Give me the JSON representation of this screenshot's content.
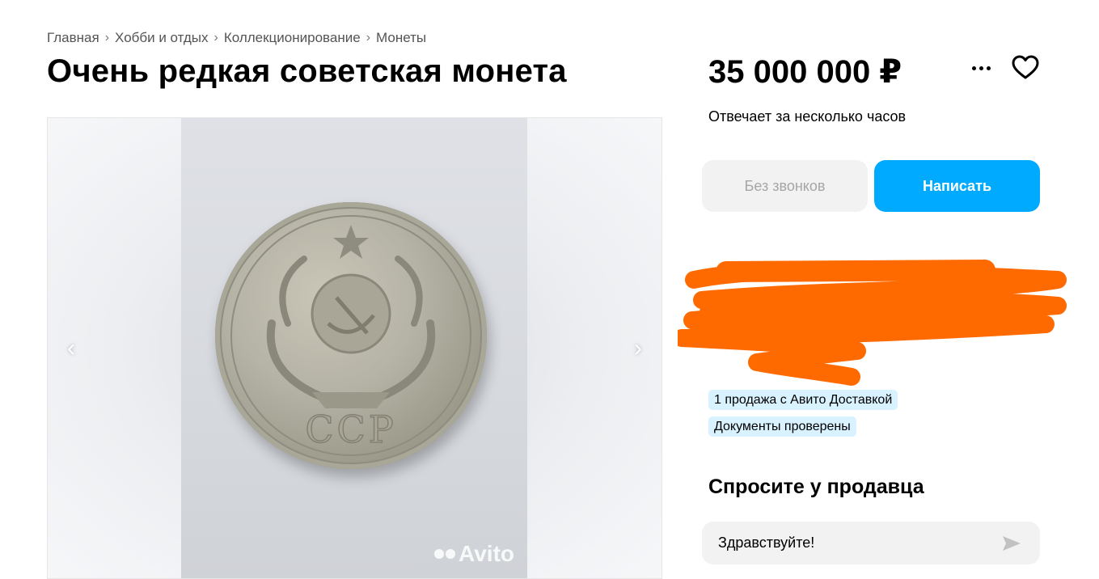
{
  "breadcrumb": [
    "Главная",
    "Хобби и отдых",
    "Коллекционирование",
    "Монеты"
  ],
  "breadcrumb_separator": "›",
  "title": "Очень редкая советская монета",
  "gallery": {
    "watermark": "Avito",
    "coin_inscription": "ССР",
    "prev_icon": "chevron-left-icon",
    "next_icon": "chevron-right-icon"
  },
  "price": "35 000 000 ₽",
  "icons": {
    "more": "more-dots-icon",
    "favorite": "heart-icon",
    "send": "send-arrow-icon"
  },
  "response_time": "Отвечает за несколько часов",
  "buttons": {
    "no_calls": "Без звонков",
    "write": "Написать"
  },
  "badges": [
    "1 продажа с Авито Доставкой",
    "Документы проверены"
  ],
  "ask": {
    "title": "Спросите у продавца",
    "message": "Здравствуйте!"
  },
  "colors": {
    "accent": "#00aaff",
    "badge_bg": "#d9f2ff",
    "redaction": "#ff6a00"
  }
}
